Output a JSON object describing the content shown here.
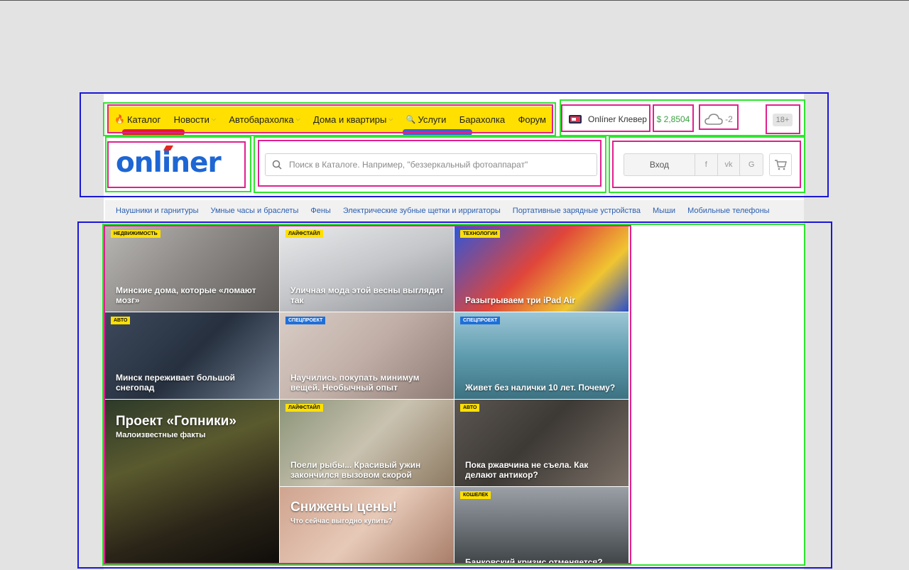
{
  "nav": {
    "items": [
      {
        "label": "Каталог",
        "icon": "fire-icon",
        "chevron": false
      },
      {
        "label": "Новости",
        "chevron": true
      },
      {
        "label": "Автобарахолка",
        "chevron": true
      },
      {
        "label": "Дома и квартиры",
        "chevron": true
      },
      {
        "label": "Услуги",
        "icon": "search-icon",
        "chevron": false
      },
      {
        "label": "Барахолка",
        "chevron": false
      },
      {
        "label": "Форум",
        "chevron": false
      }
    ]
  },
  "header": {
    "klever": "Onlíner Клевер",
    "rate": "$ 2,8504",
    "weather": "-2",
    "age": "18+"
  },
  "logo": "onliner",
  "search": {
    "placeholder": "Поиск в Каталоге. Например, \"беззеркальный фотоаппарат\""
  },
  "auth": {
    "login": "Вход",
    "social": [
      "f",
      "vk",
      "G"
    ]
  },
  "categories": [
    "Наушники и гарнитуры",
    "Умные часы и браслеты",
    "Фены",
    "Электрические зубные щетки и ирригаторы",
    "Портативные зарядные устройства",
    "Мыши",
    "Мобильные телефоны"
  ],
  "tiles": [
    {
      "tag": "Недвижимость",
      "title": "Минские дома, которые «ломают мозг»"
    },
    {
      "tag": "Лайфстайл",
      "title": "Уличная мода этой весны выглядит так"
    },
    {
      "tag": "Технологии",
      "title": "Разыгрываем три iPad Air"
    },
    {
      "tag": "Авто",
      "title": "Минск переживает большой снегопад"
    },
    {
      "tag": "Спецпроект",
      "title": "Научились покупать минимум вещей. Необычный опыт"
    },
    {
      "tag": "Спецпроект",
      "title": "Живет без налички 10 лет. Почему?"
    },
    {
      "title": "Проект «Гопники»",
      "subtitle": "Малоизвестные факты"
    },
    {
      "tag": "Лайфстайл",
      "title": "Поели рыбы... Красивый ужин закончился вызовом скорой"
    },
    {
      "tag": "Авто",
      "title": "Пока ржавчина не съела. Как делают антикор?"
    },
    {
      "title": "Снижены цены!",
      "subtitle": "Что сейчас выгодно купить?"
    },
    {
      "tag": "Кошелек",
      "title": "Банковский кризис отменяется?"
    }
  ]
}
